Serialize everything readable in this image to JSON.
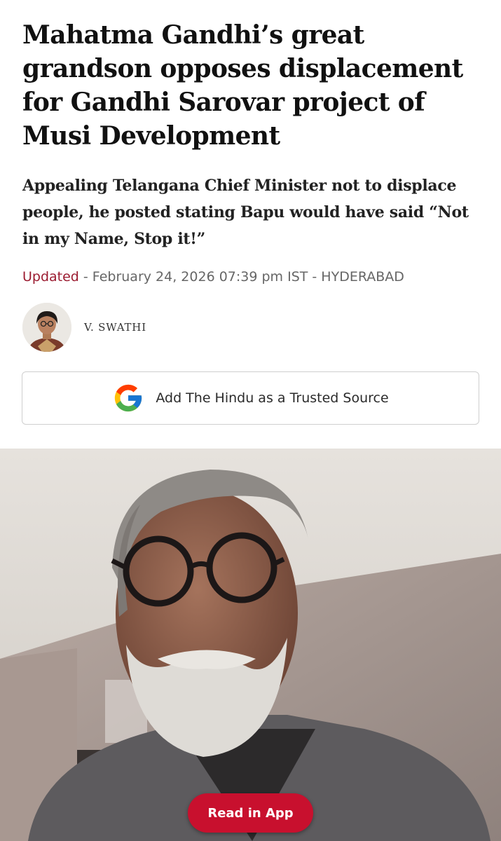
{
  "article": {
    "headline": "Mahatma Gandhi’s great grandson opposes displacement for Gandhi Sarovar project of Musi Development",
    "subheadline": "Appealing Telangana Chief Minister not to displace people, he posted stating Bapu would have said “Not in my Name, Stop it!”",
    "updated_label": "Updated",
    "dateline": " - February 24, 2026 07:39 pm IST - HYDERABAD",
    "author": "V. SWATHI"
  },
  "trusted_source": {
    "label": "Add The Hindu as a Trusted Source",
    "icon": "google-g-icon"
  },
  "read_in_app": {
    "label": "Read in App"
  },
  "colors": {
    "accent": "#c8102e",
    "updated": "#9b1b30"
  }
}
